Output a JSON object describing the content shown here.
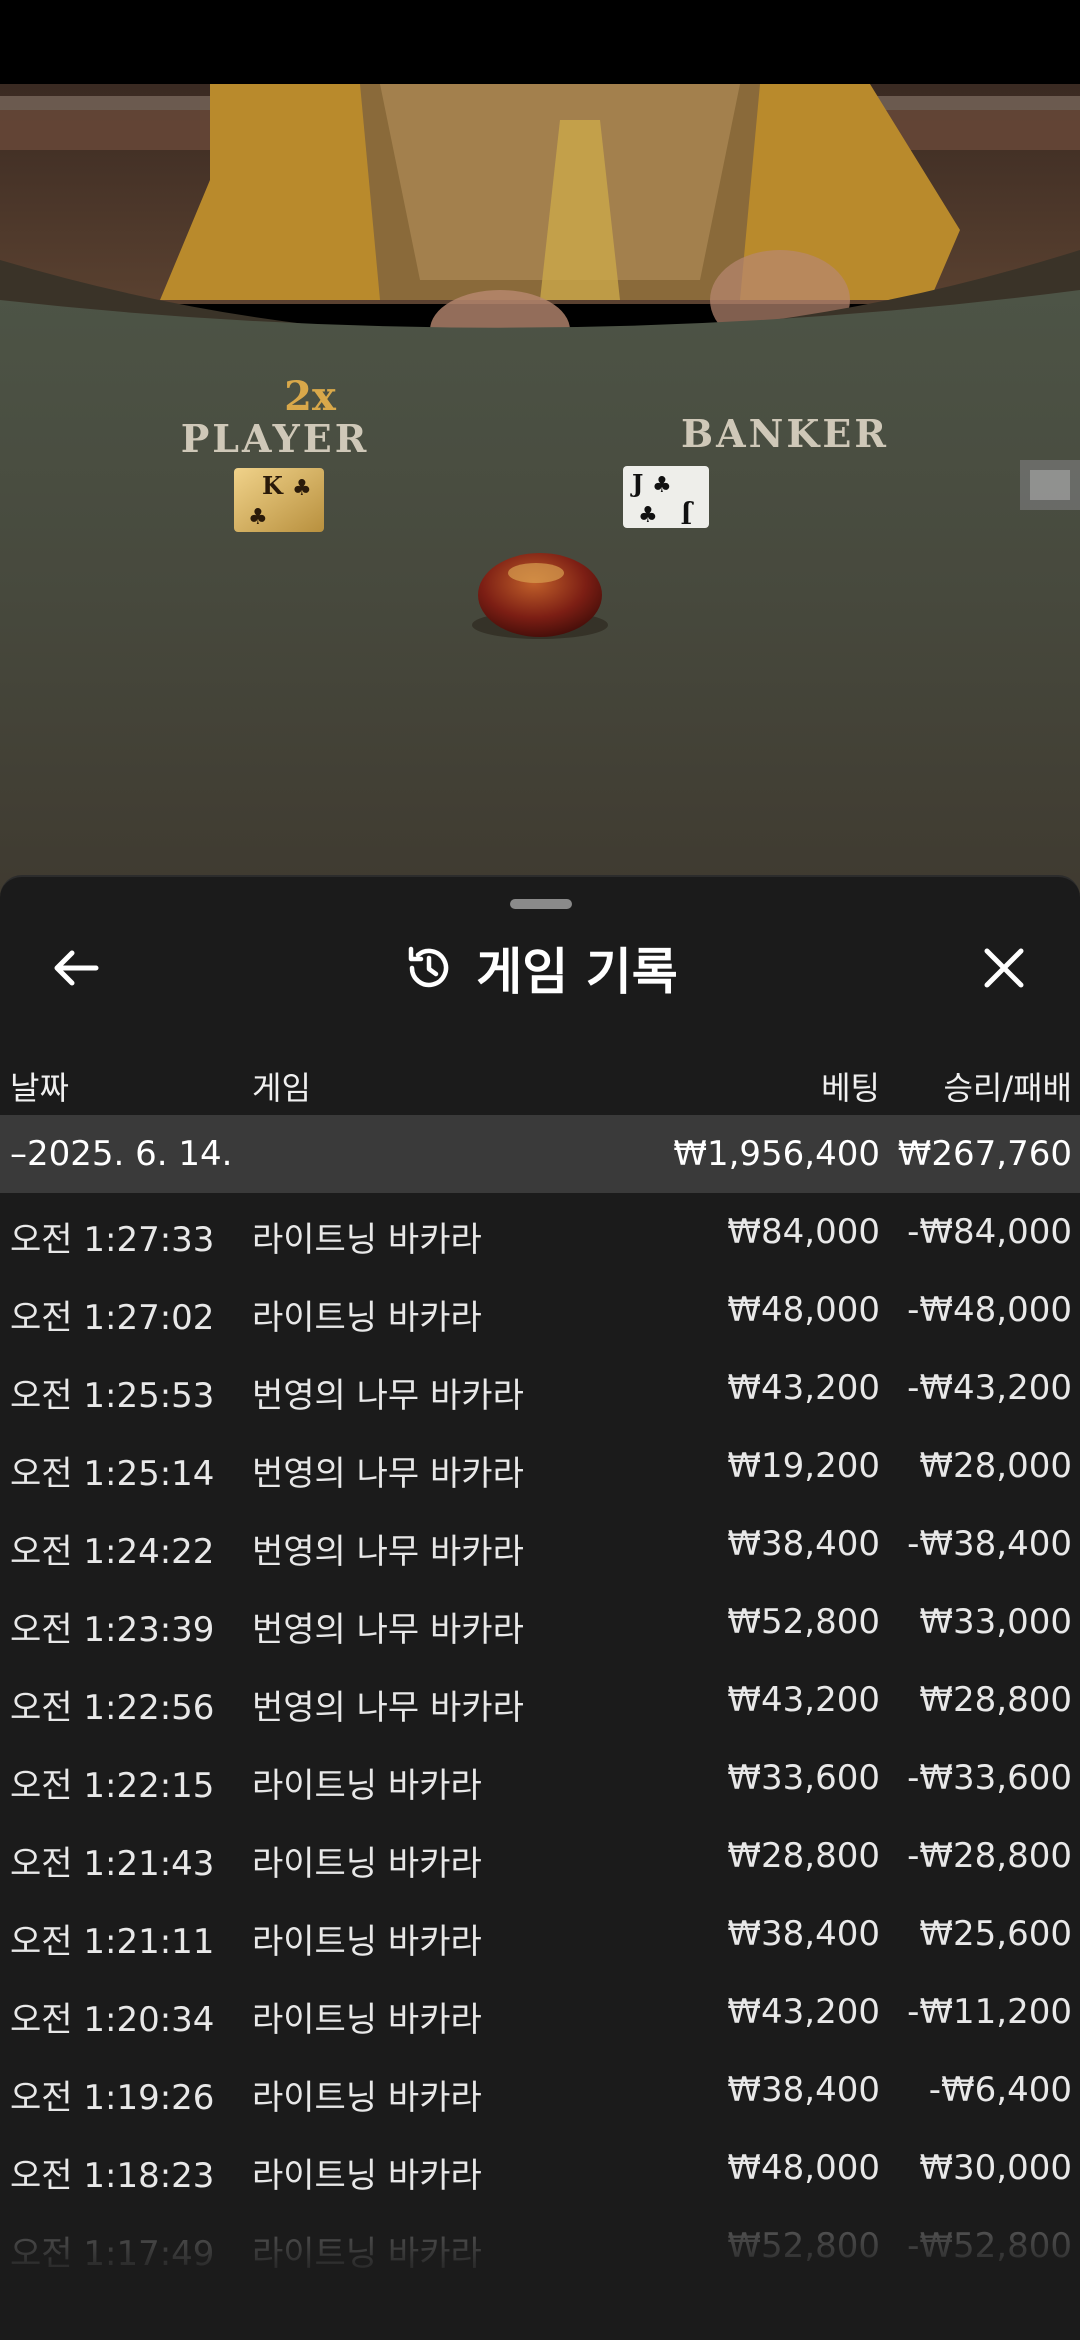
{
  "video": {
    "player_multiplier": "2x",
    "player_label": "PLAYER",
    "banker_label": "BANKER",
    "player_card_rank": "K",
    "banker_card_rank": "J"
  },
  "header": {
    "title": "게임 기록",
    "back_icon": "arrow-left-icon",
    "history_icon": "history-clock-icon",
    "close_icon": "close-icon"
  },
  "columns": {
    "date": "날짜",
    "game": "게임",
    "bet": "베팅",
    "win_loss": "승리/패배"
  },
  "summary": {
    "date": "–2025. 6. 14.",
    "bet": "₩1,956,400",
    "win_loss": "₩267,760"
  },
  "rows": [
    {
      "time": "오전 1:27:33",
      "game": "라이트닝 바카라",
      "bet": "₩84,000",
      "win_loss": "-₩84,000"
    },
    {
      "time": "오전 1:27:02",
      "game": "라이트닝 바카라",
      "bet": "₩48,000",
      "win_loss": "-₩48,000"
    },
    {
      "time": "오전 1:25:53",
      "game": "번영의 나무 바카라",
      "bet": "₩43,200",
      "win_loss": "-₩43,200"
    },
    {
      "time": "오전 1:25:14",
      "game": "번영의 나무 바카라",
      "bet": "₩19,200",
      "win_loss": "₩28,000"
    },
    {
      "time": "오전 1:24:22",
      "game": "번영의 나무 바카라",
      "bet": "₩38,400",
      "win_loss": "-₩38,400"
    },
    {
      "time": "오전 1:23:39",
      "game": "번영의 나무 바카라",
      "bet": "₩52,800",
      "win_loss": "₩33,000"
    },
    {
      "time": "오전 1:22:56",
      "game": "번영의 나무 바카라",
      "bet": "₩43,200",
      "win_loss": "₩28,800"
    },
    {
      "time": "오전 1:22:15",
      "game": "라이트닝 바카라",
      "bet": "₩33,600",
      "win_loss": "-₩33,600"
    },
    {
      "time": "오전 1:21:43",
      "game": "라이트닝 바카라",
      "bet": "₩28,800",
      "win_loss": "-₩28,800"
    },
    {
      "time": "오전 1:21:11",
      "game": "라이트닝 바카라",
      "bet": "₩38,400",
      "win_loss": "₩25,600"
    },
    {
      "time": "오전 1:20:34",
      "game": "라이트닝 바카라",
      "bet": "₩43,200",
      "win_loss": "-₩11,200"
    },
    {
      "time": "오전 1:19:26",
      "game": "라이트닝 바카라",
      "bet": "₩38,400",
      "win_loss": "-₩6,400"
    },
    {
      "time": "오전 1:18:23",
      "game": "라이트닝 바카라",
      "bet": "₩48,000",
      "win_loss": "₩30,000"
    },
    {
      "time": "오전 1:17:49",
      "game": "라이트닝 바카라",
      "bet": "₩52,800",
      "win_loss": "-₩52,800"
    }
  ]
}
